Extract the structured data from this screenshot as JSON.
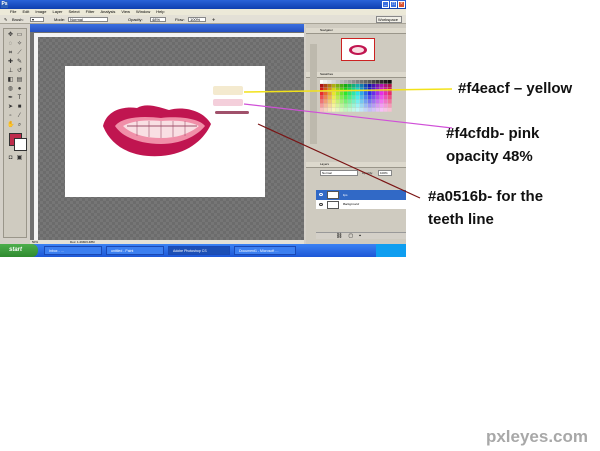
{
  "window": {
    "menu_items": [
      "File",
      "Edit",
      "Image",
      "Layer",
      "Select",
      "Filter",
      "Analysis",
      "View",
      "Window",
      "Help"
    ],
    "options": {
      "tool_label": "Brush:",
      "mode_label": "Mode:",
      "mode_value": "Normal",
      "opacity_label": "Opacity:",
      "opacity_value": "48%",
      "flow_label": "Flow:",
      "flow_value": "100%",
      "workspace_label": "Workspace"
    },
    "status": {
      "zoom": "50%",
      "doc_size": "Doc: 1.29M/3.48M"
    },
    "panels": {
      "navigator_tab": "Navigator",
      "swatches_tab": "Swatches",
      "layers_tab": "Layers",
      "blend_mode": "Normal",
      "opacity_label": "Opacity:",
      "opacity_value": "100%",
      "layers": [
        {
          "name": "lips",
          "selected": true
        },
        {
          "name": "Background",
          "selected": false
        }
      ]
    }
  },
  "taskbar": {
    "start_label": "start",
    "buttons": [
      "Inbox - …",
      "untitled - Paint",
      "Adobe Photoshop CS",
      "Document1 - Microsoft …"
    ],
    "tray_time": "—"
  },
  "swatch_colors": {
    "yellow": "#f4eacf",
    "pink": "#f4cfdb",
    "teeth_line": "#a0516b"
  },
  "annotations": {
    "yellow": "#f4eacf – yellow",
    "pink_line1": "#f4cfdb- pink",
    "pink_line2": "opacity 48%",
    "teeth_line1": "#a0516b- for the",
    "teeth_line2": "teeth line"
  },
  "watermark": "pxleyes.com"
}
